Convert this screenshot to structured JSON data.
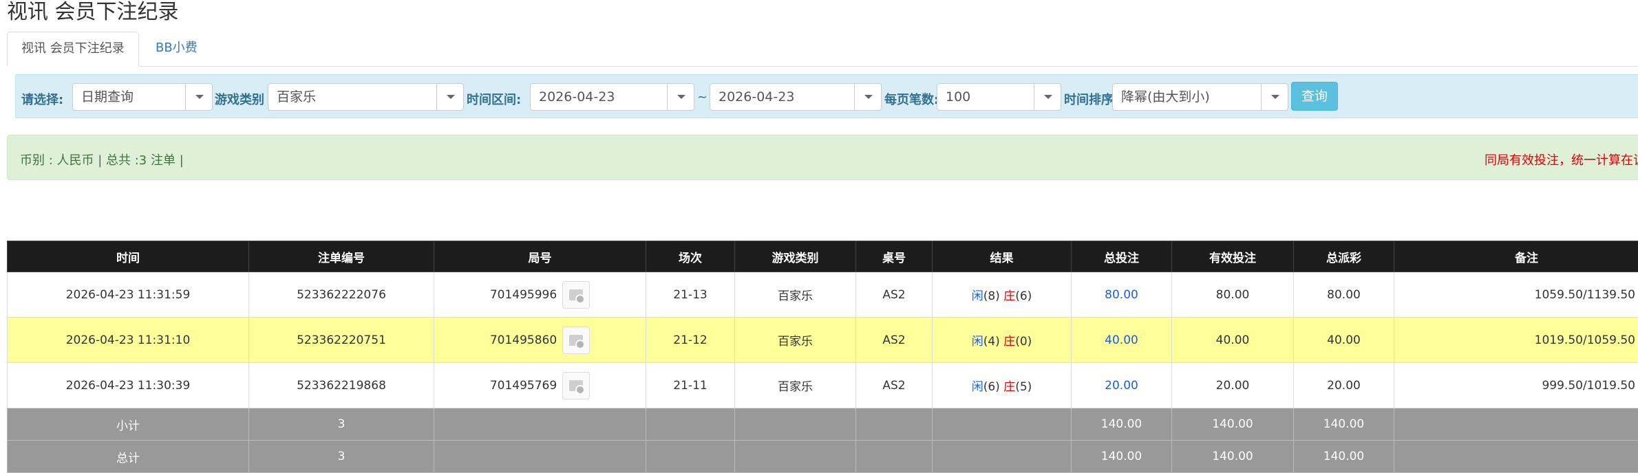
{
  "page": {
    "title": "视讯 会员下注纪录"
  },
  "tabs": [
    {
      "label": "视讯 会员下注纪录"
    },
    {
      "label": "BB小费"
    }
  ],
  "filter": {
    "select_label": "请选择:",
    "select_value": "日期查询",
    "game_label": "游戏类别",
    "game_value": "百家乐",
    "range_label": "时间区间:",
    "start_date": "2026-04-23",
    "tilde": "~",
    "end_date": "2026-04-23",
    "per_page_label": "每页笔数:",
    "per_page_value": "100",
    "sort_label": "时间排序:",
    "sort_value": "降幂(由大到小)",
    "query_button": "查询"
  },
  "summary": {
    "left": "币别 : 人民币 | 总共 :3 注单 |",
    "right": "同局有效投注，统一计算在该"
  },
  "table": {
    "headers": [
      "时间",
      "注单编号",
      "局号",
      "场次",
      "游戏类别",
      "桌号",
      "结果",
      "总投注",
      "有效投注",
      "总派彩",
      "备注"
    ],
    "rows": [
      {
        "time": "2026-04-23 11:31:59",
        "order_id": "523362222076",
        "round_id": "701495996",
        "session": "21-13",
        "game": "百家乐",
        "table": "AS2",
        "player_label": "闲",
        "player_score": "(8)",
        "banker_label": "庄",
        "banker_score": "(6)",
        "total_bet": "80.00",
        "valid_bet": "80.00",
        "payout": "80.00",
        "remark": "1059.50/1139.50"
      },
      {
        "time": "2026-04-23 11:31:10",
        "order_id": "523362220751",
        "round_id": "701495860",
        "session": "21-12",
        "game": "百家乐",
        "table": "AS2",
        "player_label": "闲",
        "player_score": "(4)",
        "banker_label": "庄",
        "banker_score": "(0)",
        "total_bet": "40.00",
        "valid_bet": "40.00",
        "payout": "40.00",
        "remark": "1019.50/1059.50"
      },
      {
        "time": "2026-04-23 11:30:39",
        "order_id": "523362219868",
        "round_id": "701495769",
        "session": "21-11",
        "game": "百家乐",
        "table": "AS2",
        "player_label": "闲",
        "player_score": "(6)",
        "banker_label": "庄",
        "banker_score": "(5)",
        "total_bet": "20.00",
        "valid_bet": "20.00",
        "payout": "20.00",
        "remark": "999.50/1019.50"
      }
    ],
    "subtotal": {
      "label": "小计",
      "count": "3",
      "total_bet": "140.00",
      "valid_bet": "140.00",
      "payout": "140.00"
    },
    "total": {
      "label": "总计",
      "count": "3",
      "total_bet": "140.00",
      "valid_bet": "140.00",
      "payout": "140.00"
    }
  }
}
